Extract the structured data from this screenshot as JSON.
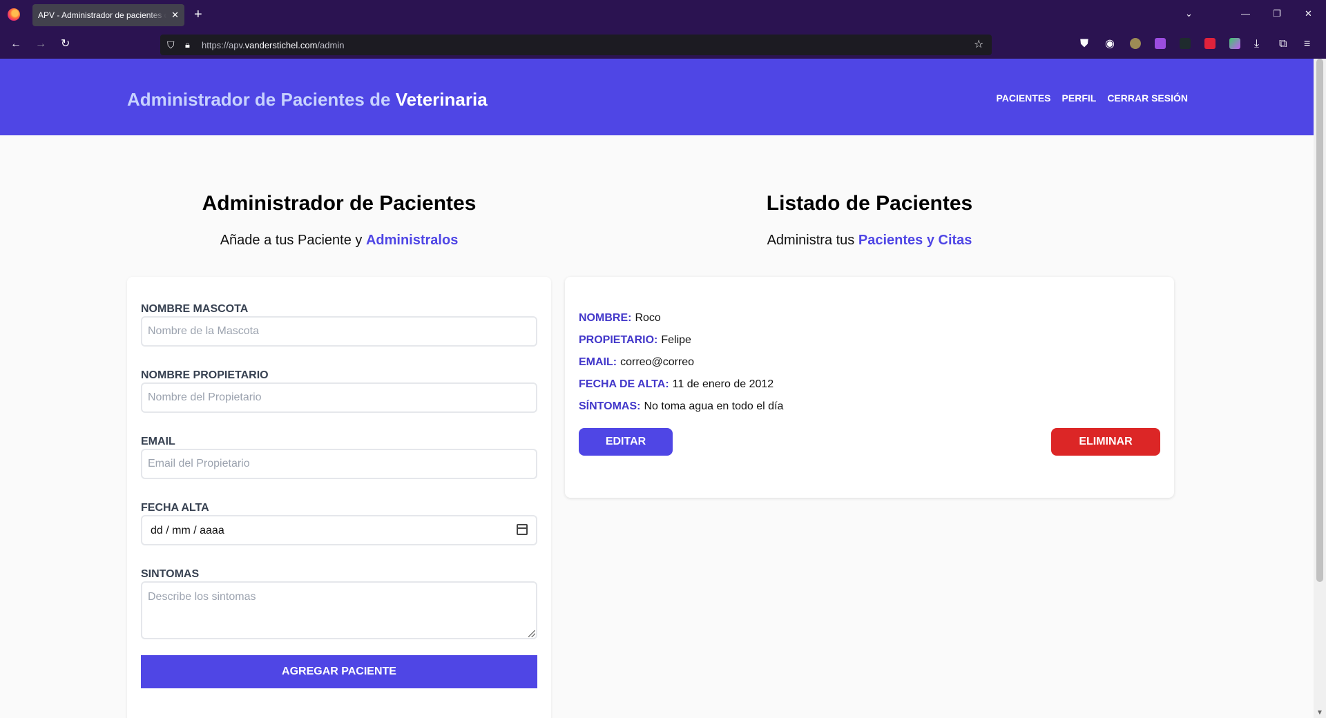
{
  "browser": {
    "tab_title": "APV - Administrador de pacientes de Veterinaria",
    "tab_close": "✕",
    "new_tab": "+",
    "url_prefix": "https://apv.",
    "url_host": "vanderstichel.com",
    "url_path": "/admin",
    "window_controls": [
      "⌄",
      "—",
      "❐",
      "✕"
    ],
    "nav_icons": [
      "back-icon",
      "forward-icon",
      "reload-icon"
    ],
    "toolbar_icons": [
      "pocket-icon",
      "account-icon",
      "extension-icon",
      "extension-icon",
      "extension-icon",
      "extension-icon",
      "extension-icon",
      "downloads-icon",
      "extensions-icon",
      "menu-icon"
    ]
  },
  "header": {
    "brand_prefix": "Administrador de Pacientes de",
    "brand_highlight": "Veterinaria",
    "nav": [
      "Pacientes",
      "Perfil",
      "Cerrar Sesión"
    ]
  },
  "left": {
    "title": "Administrador de Pacientes",
    "subtitle_prefix": "Añade a tus Paciente y",
    "subtitle_accent": "Administralos"
  },
  "right": {
    "title": "Listado de Pacientes",
    "subtitle_prefix": "Administra tus",
    "subtitle_accent": "Pacientes y Citas"
  },
  "form": {
    "fields": [
      {
        "label": "Nombre Mascota",
        "placeholder": "Nombre de la Mascota",
        "value": ""
      },
      {
        "label": "Nombre Propietario",
        "placeholder": "Nombre del Propietario",
        "value": ""
      },
      {
        "label": "Email",
        "placeholder": "Email del Propietario",
        "value": ""
      },
      {
        "label": "Fecha Alta",
        "placeholder": "dd / mm / aaaa",
        "value": ""
      },
      {
        "label": "Sintomas",
        "placeholder": "Describe los sintomas",
        "value": ""
      }
    ],
    "submit_label": "Agregar Paciente"
  },
  "patient": {
    "rows": [
      {
        "key": "Nombre:",
        "value": "Roco"
      },
      {
        "key": "Propietario:",
        "value": "Felipe"
      },
      {
        "key": "Email:",
        "value": "correo@correo"
      },
      {
        "key": "Fecha de Alta:",
        "value": "11 de enero de 2012"
      },
      {
        "key": "Síntomas:",
        "value": "No toma agua en todo el día"
      }
    ],
    "edit_label": "Editar",
    "delete_label": "Eliminar"
  },
  "colors": {
    "primary": "#4f46e5",
    "danger": "#dc2626",
    "browser_chrome": "#2b1351"
  }
}
